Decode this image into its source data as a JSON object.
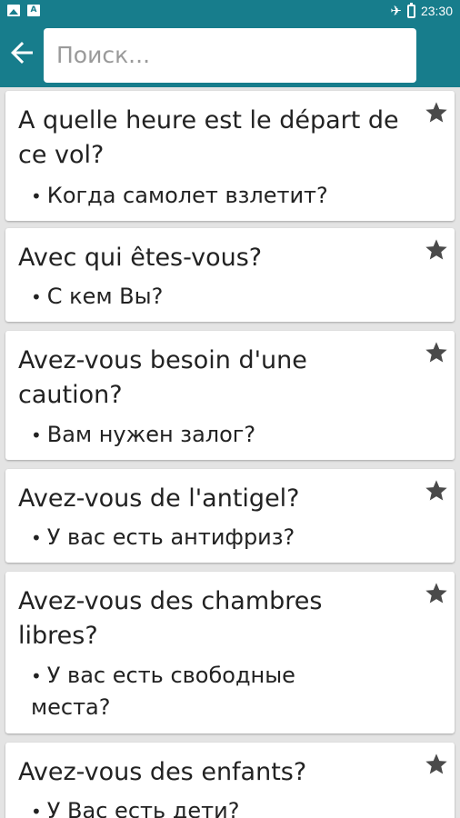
{
  "status": {
    "time": "23:30",
    "left_icons": [
      "image-icon",
      "a-icon"
    ],
    "right_icons": [
      "airplane-icon",
      "battery-icon"
    ]
  },
  "appbar": {
    "back_icon": "arrow-left-icon",
    "search_placeholder": "Поиск..."
  },
  "phrases": [
    {
      "fr": "A quelle heure est le départ de ce vol?",
      "ru": "Когда самолет взлетит?",
      "bullet": "•"
    },
    {
      "fr": "Avec qui êtes-vous?",
      "ru": "С кем Вы?",
      "bullet": "•"
    },
    {
      "fr": "Avez-vous besoin d'une caution?",
      "ru": "Вам нужен залог?",
      "bullet": "•"
    },
    {
      "fr": "Avez-vous de l'antigel?",
      "ru": "У вас есть антифриз?",
      "bullet": "•"
    },
    {
      "fr": "Avez-vous des chambres libres?",
      "ru": "У вас есть свободные места?",
      "bullet": "•"
    },
    {
      "fr": "Avez-vous des enfants?",
      "ru": "У Вас есть дети?",
      "bullet": "•"
    }
  ],
  "colors": {
    "primary": "#177d8c",
    "background": "#e4e4e4",
    "star": "#4a4a4a"
  }
}
